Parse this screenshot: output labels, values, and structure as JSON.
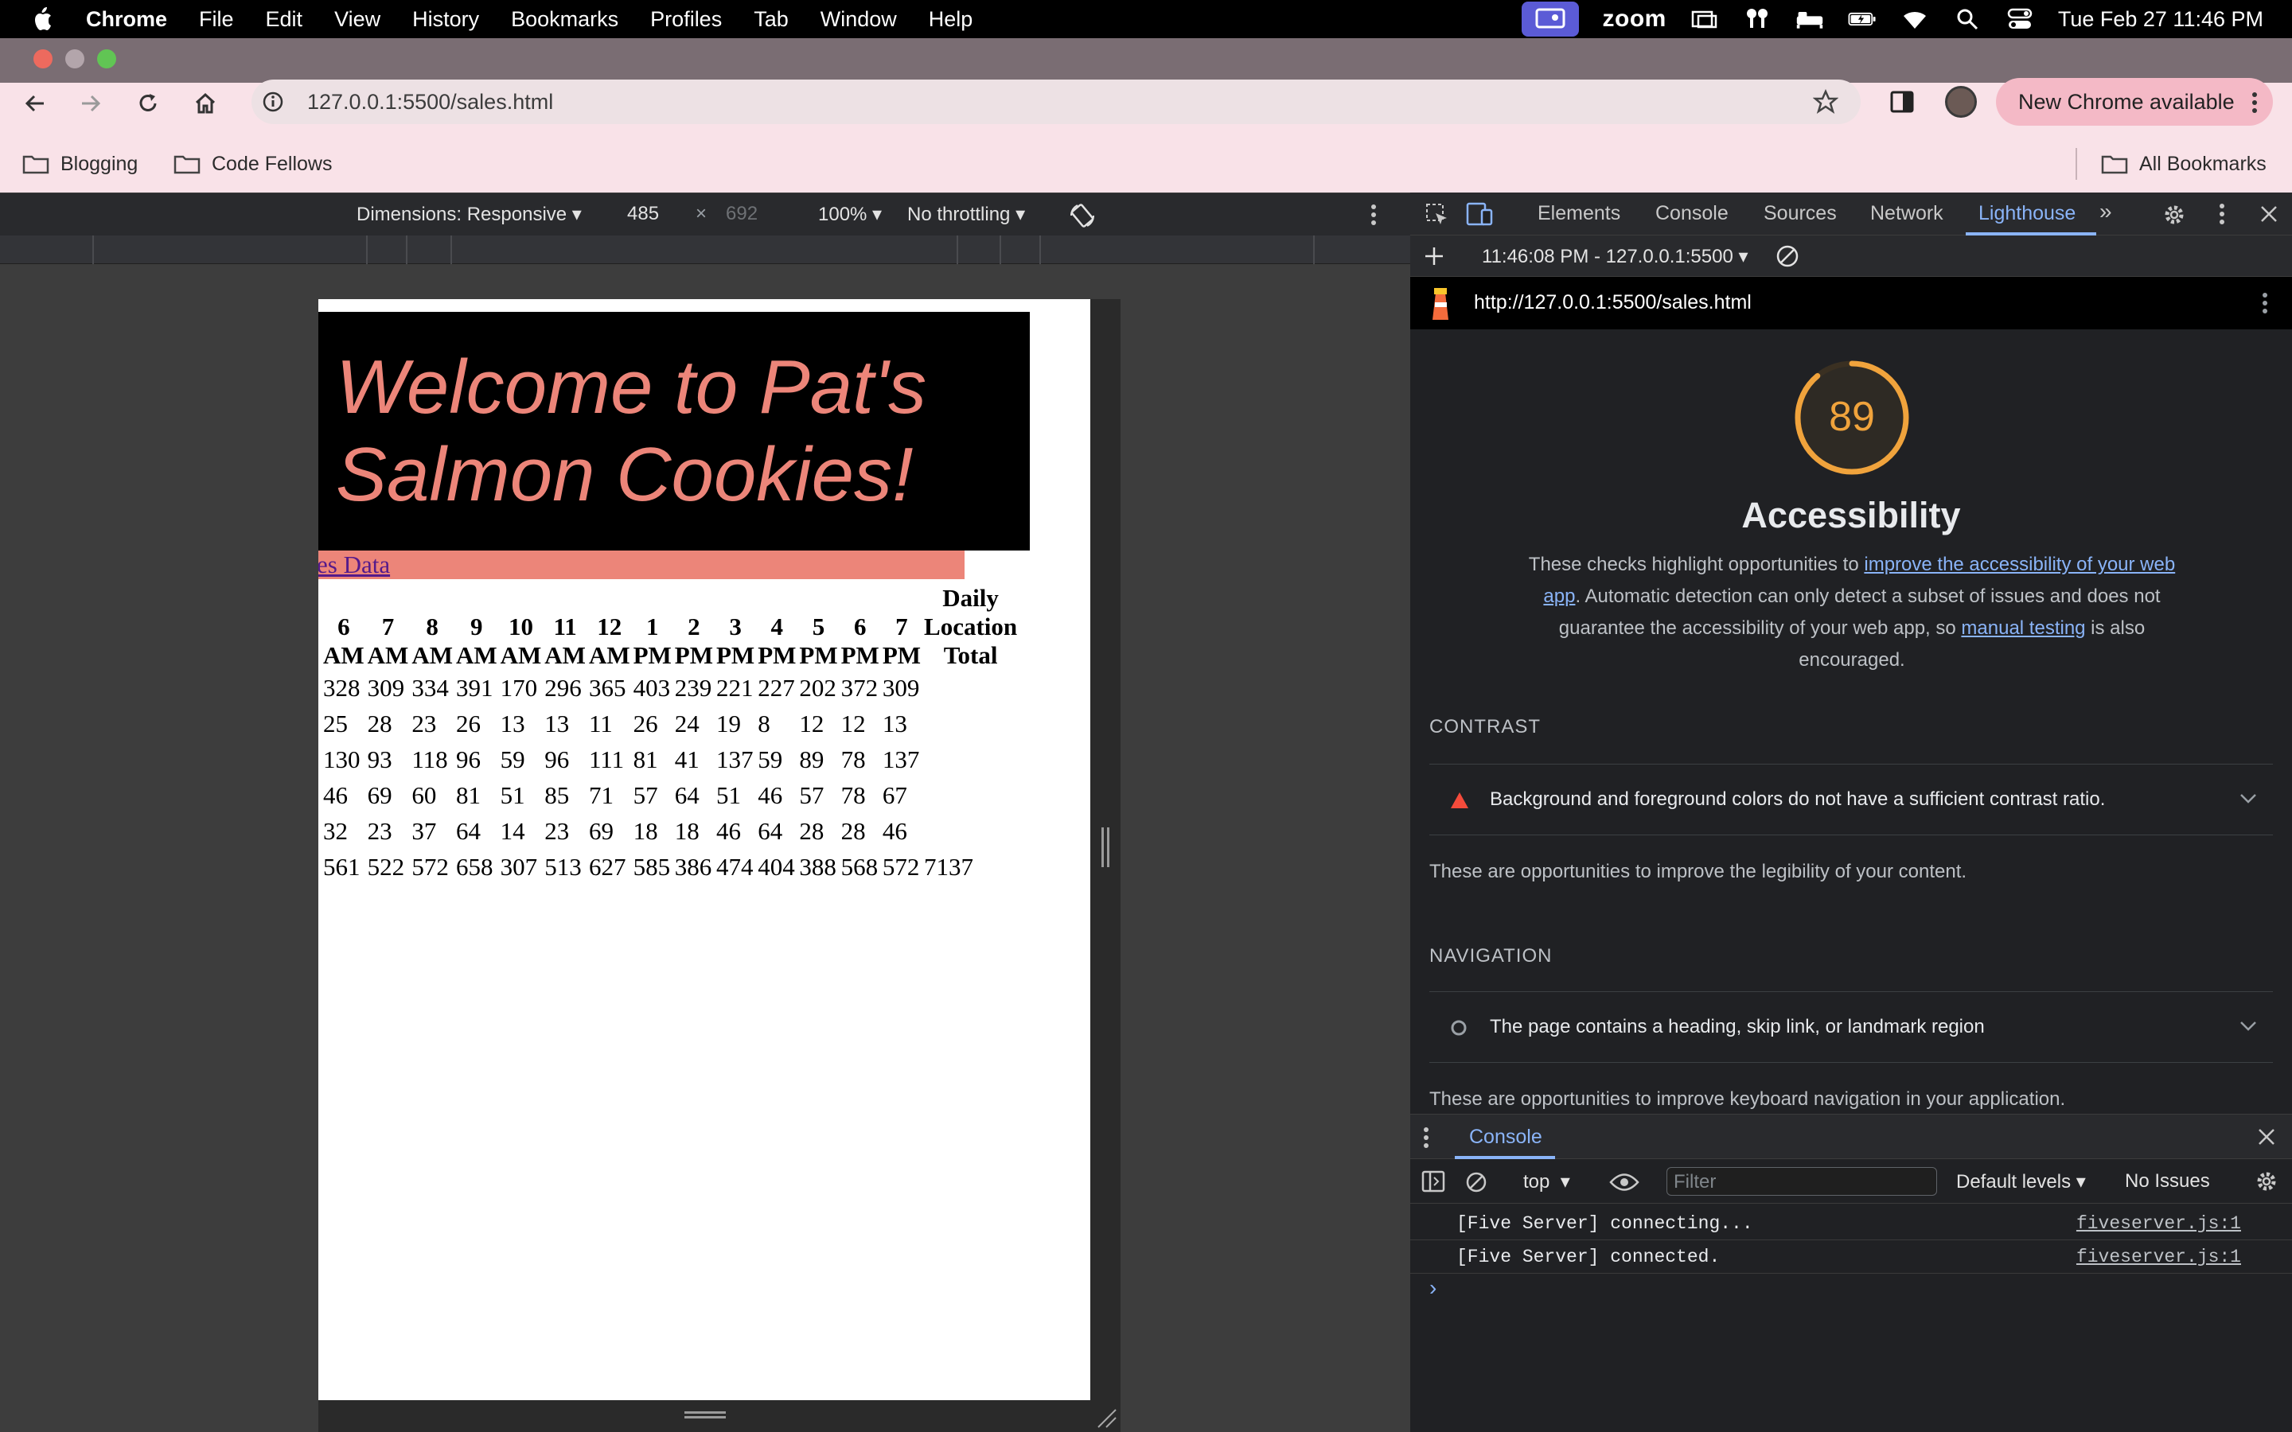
{
  "menubar": {
    "app": "Chrome",
    "items": [
      "File",
      "Edit",
      "View",
      "History",
      "Bookmarks",
      "Profiles",
      "Tab",
      "Window",
      "Help"
    ],
    "zoom": "zoom",
    "datetime": "Tue Feb 27  11:46 PM"
  },
  "browser": {
    "url": "127.0.0.1:5500/sales.html",
    "update_label": "New Chrome available",
    "bookmarks": [
      "Blogging",
      "Code Fellows"
    ],
    "all_bookmarks": "All Bookmarks"
  },
  "device_toolbar": {
    "dimensions": "Dimensions: Responsive",
    "width": "485",
    "times": "×",
    "height": "692",
    "zoom": "100%",
    "throttling": "No throttling"
  },
  "page": {
    "title_line1": "Welcome to Pat's",
    "title_line2": "Salmon Cookies!",
    "nav_link": "es Data",
    "table": {
      "hours": [
        [
          "6",
          "AM"
        ],
        [
          "7",
          "AM"
        ],
        [
          "8",
          "AM"
        ],
        [
          "9",
          "AM"
        ],
        [
          "10",
          "AM"
        ],
        [
          "11",
          "AM"
        ],
        [
          "12",
          "AM"
        ],
        [
          "1",
          "PM"
        ],
        [
          "2",
          "PM"
        ],
        [
          "3",
          "PM"
        ],
        [
          "4",
          "PM"
        ],
        [
          "5",
          "PM"
        ],
        [
          "6",
          "PM"
        ],
        [
          "7",
          "PM"
        ]
      ],
      "total_header": [
        "Daily",
        "Location",
        "Total"
      ],
      "rows": [
        [
          "328",
          "309",
          "334",
          "391",
          "170",
          "296",
          "365",
          "403",
          "239",
          "221",
          "227",
          "202",
          "372",
          "309",
          ""
        ],
        [
          "25",
          "28",
          "23",
          "26",
          "13",
          "13",
          "11",
          "26",
          "24",
          "19",
          "8",
          "12",
          "12",
          "13",
          ""
        ],
        [
          "130",
          "93",
          "118",
          "96",
          "59",
          "96",
          "111",
          "81",
          "41",
          "137",
          "59",
          "89",
          "78",
          "137",
          ""
        ],
        [
          "46",
          "69",
          "60",
          "81",
          "51",
          "85",
          "71",
          "57",
          "64",
          "51",
          "46",
          "57",
          "78",
          "67",
          ""
        ],
        [
          "32",
          "23",
          "37",
          "64",
          "14",
          "23",
          "69",
          "18",
          "18",
          "46",
          "64",
          "28",
          "28",
          "46",
          ""
        ],
        [
          "561",
          "522",
          "572",
          "658",
          "307",
          "513",
          "627",
          "585",
          "386",
          "474",
          "404",
          "388",
          "568",
          "572",
          "7137"
        ]
      ]
    }
  },
  "devtools": {
    "tabs": [
      "Elements",
      "Console",
      "Sources",
      "Network",
      "Lighthouse"
    ],
    "active_tab": "Lighthouse",
    "report_select": "11:46:08 PM - 127.0.0.1:5500",
    "report_url": "http://127.0.0.1:5500/sales.html",
    "score": "89",
    "score_fraction": 0.89,
    "score_color": "#f0a33c",
    "category": "Accessibility",
    "desc_1": "These checks highlight opportunities to ",
    "desc_link1": "improve the accessibility of your web app",
    "desc_2": ". Automatic detection can only detect a subset of issues and does not guarantee the accessibility of your web app, so ",
    "desc_link2": "manual testing",
    "desc_3": " is also encouraged.",
    "contrast_heading": "CONTRAST",
    "contrast_audit": "Background and foreground colors do not have a sufficient contrast ratio.",
    "contrast_note": "These are opportunities to improve the legibility of your content.",
    "nav_heading": "NAVIGATION",
    "nav_audit": "The page contains a heading, skip link, or landmark region",
    "nav_note": "These are opportunities to improve keyboard navigation in your application.",
    "drawer_tab": "Console",
    "context": "top",
    "filter_placeholder": "Filter",
    "levels": "Default levels",
    "issues": "No Issues",
    "logs": [
      {
        "msg": "[Five Server] connecting...",
        "src": "fiveserver.js:1"
      },
      {
        "msg": "[Five Server] connected.",
        "src": "fiveserver.js:1"
      }
    ],
    "prompt": "›"
  }
}
